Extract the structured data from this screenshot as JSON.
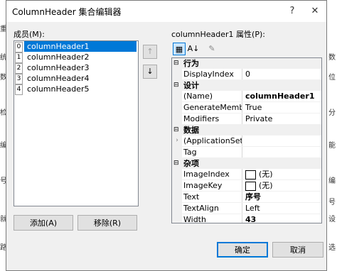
{
  "window": {
    "title": "ColumnHeader 集合编辑器",
    "help_glyph": "?",
    "close_glyph": "✕"
  },
  "members": {
    "label": "成员(M):",
    "items": [
      {
        "index": "0",
        "name": "columnHeader1",
        "selected": true
      },
      {
        "index": "1",
        "name": "columnHeader2"
      },
      {
        "index": "2",
        "name": "columnHeader3"
      },
      {
        "index": "3",
        "name": "columnHeader4"
      },
      {
        "index": "4",
        "name": "columnHeader5"
      }
    ],
    "move_up_glyph": "↑",
    "move_down_glyph": "↓",
    "add_label": "添加(A)",
    "remove_label": "移除(R)"
  },
  "properties": {
    "label": "columnHeader1 属性(P):",
    "toolbar": {
      "categorized_glyph": "▦",
      "alphabetical_glyph": "A↓",
      "pages_glyph": "✎"
    },
    "categories": [
      {
        "name": "行为",
        "toggle": "⊟",
        "rows": [
          {
            "name": "DisplayIndex",
            "value": "0"
          }
        ]
      },
      {
        "name": "设计",
        "toggle": "⊟",
        "rows": [
          {
            "name": "(Name)",
            "value": "columnHeader1",
            "bold": true
          },
          {
            "name": "GenerateMembe",
            "value": "True"
          },
          {
            "name": "Modifiers",
            "value": "Private"
          }
        ]
      },
      {
        "name": "数据",
        "toggle": "⊟",
        "rows": [
          {
            "name": "(ApplicationSettin",
            "value": "",
            "expand": "›"
          },
          {
            "name": "Tag",
            "value": ""
          }
        ]
      },
      {
        "name": "杂项",
        "toggle": "⊟",
        "rows": [
          {
            "name": "ImageIndex",
            "value": "(无)",
            "swatch": true
          },
          {
            "name": "ImageKey",
            "value": "(无)",
            "swatch": true
          },
          {
            "name": "Text",
            "value": "序号",
            "bold": true
          },
          {
            "name": "TextAlign",
            "value": "Left"
          },
          {
            "name": "Width",
            "value": "43",
            "bold": true
          }
        ]
      }
    ]
  },
  "buttons": {
    "ok": "确定",
    "cancel": "取消"
  },
  "background": {
    "left_glyphs": [
      "重",
      "统",
      "数",
      "检",
      "编",
      "号",
      "就",
      "路"
    ],
    "right_glyphs": [
      "数",
      "位",
      "分",
      "能",
      "编",
      "号",
      "设",
      "选"
    ]
  }
}
